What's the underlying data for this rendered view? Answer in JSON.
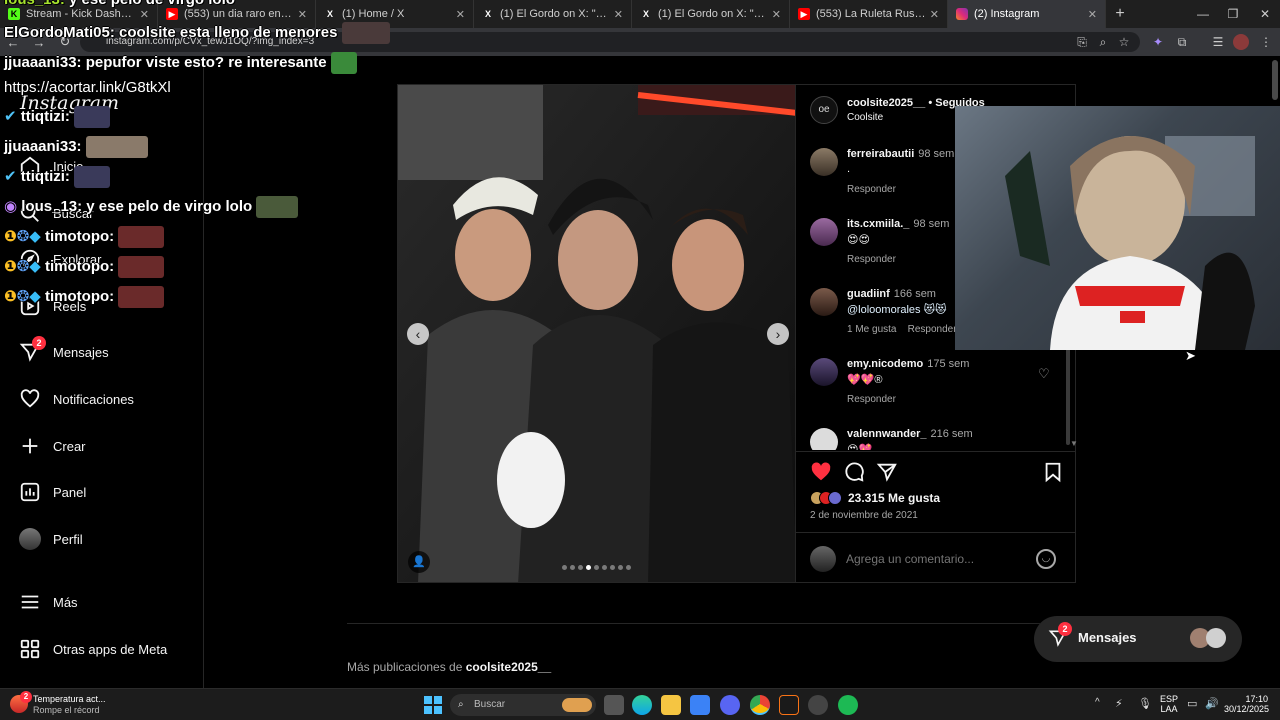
{
  "browser": {
    "tabs": [
      {
        "title": "Stream - Kick Dashboard",
        "icon": "kick-icon",
        "color": "#53fc18"
      },
      {
        "title": "(553) un dia raro en el chat - Yo",
        "icon": "youtube-icon",
        "color": "#ff0000"
      },
      {
        "title": "(1) Home / X",
        "icon": "x-icon",
        "color": "#ffffff"
      },
      {
        "title": "(1) El Gordo on X: \"Cuando",
        "icon": "x-icon",
        "color": "#ffffff"
      },
      {
        "title": "(1) El Gordo on X: \"Waat hi",
        "icon": "x-icon",
        "color": "#ffffff"
      },
      {
        "title": "(553) La Ruleta Rusa Real Que",
        "icon": "youtube-icon",
        "color": "#ff0000"
      },
      {
        "title": "(2) Instagram",
        "icon": "instagram-icon",
        "color": "#e1306c",
        "active": true
      }
    ],
    "url": "instagram.com/p/CVx_tewJ1OQ/?img_index=3"
  },
  "sidebar": {
    "logo": "Instagram",
    "items": [
      {
        "label": "Inicio",
        "icon": "home-icon"
      },
      {
        "label": "Buscar",
        "icon": "search-icon"
      },
      {
        "label": "Explorar",
        "icon": "compass-icon"
      },
      {
        "label": "Reels",
        "icon": "reels-icon"
      },
      {
        "label": "Mensajes",
        "icon": "messenger-icon",
        "badge": "2"
      },
      {
        "label": "Notificaciones",
        "icon": "heart-icon"
      },
      {
        "label": "Crear",
        "icon": "plus-icon"
      },
      {
        "label": "Panel",
        "icon": "chart-icon"
      },
      {
        "label": "Perfil",
        "icon": "avatar"
      },
      {
        "label": "Más",
        "icon": "menu-icon"
      },
      {
        "label": "Otras apps de Meta",
        "icon": "meta-apps-icon"
      }
    ]
  },
  "post": {
    "author": "coolsite2025__",
    "following": "• Seguidos",
    "subtitle": "Coolsite",
    "comments": [
      {
        "user": "ferreirabautii",
        "time": "98 sem",
        "text": ".",
        "reply": "Responder"
      },
      {
        "user": "its.cxmiila._",
        "time": "98 sem",
        "text": "😍😍",
        "reply": "Responder"
      },
      {
        "user": "guadiinf",
        "time": "166 sem",
        "text": "@loloomorales 😻😻",
        "likes": "1 Me gusta",
        "reply": "Responder"
      },
      {
        "user": "emy.nicodemo",
        "time": "175 sem",
        "text": "💖💖®",
        "reply": "Responder"
      },
      {
        "user": "valennwander_",
        "time": "216 sem",
        "text": "😍💖",
        "reply": ""
      }
    ],
    "likes": "23.315 Me gusta",
    "date": "2 de noviembre de 2021",
    "comment_placeholder": "Agrega un comentario...",
    "carousel_dots": 9,
    "carousel_active": 3
  },
  "more_posts": {
    "prefix": "Más publicaciones de ",
    "user": "coolsite2025__"
  },
  "messages_pill": {
    "label": "Mensajes",
    "badge": "2"
  },
  "chat": [
    {
      "name": "lous_13:",
      "text": "y ese pelo de virgo lolo",
      "partial": true
    },
    {
      "name": "ElGordoMati05:",
      "text": "coolsite esta lleno de menores"
    },
    {
      "name": "jjuaaani33:",
      "text": "pepufor viste esto? re interesante"
    },
    {
      "name": "",
      "text": "https://acortar.link/G8tkXl"
    },
    {
      "name": "ttiqtizi:",
      "text": ""
    },
    {
      "name": "jjuaaani33:",
      "text": ""
    },
    {
      "name": "ttiqtizi:",
      "text": ""
    },
    {
      "name": "lous_13:",
      "text": "y ese pelo de virgo lolo"
    },
    {
      "name": "timotopo:",
      "text": ""
    },
    {
      "name": "timotopo:",
      "text": ""
    },
    {
      "name": "timotopo:",
      "text": ""
    }
  ],
  "taskbar": {
    "weather_title": "Temperatura act...",
    "weather_sub": "Rompe el récord",
    "weather_badge": "2",
    "search_placeholder": "Buscar",
    "lang": "ESP",
    "lang_sub": "LAA",
    "time": "17:10",
    "date": "30/12/2025"
  }
}
